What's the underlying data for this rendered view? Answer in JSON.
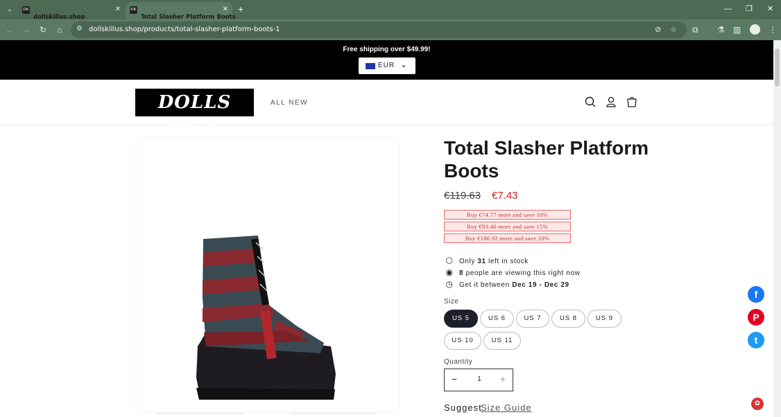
{
  "browser": {
    "tabs": [
      {
        "title": "dollskillus.shop",
        "active": false
      },
      {
        "title": "Total Slasher Platform Boots",
        "active": true
      }
    ],
    "favicon_text": "DK",
    "url": "dollskillus.shop/products/total-slasher-platform-boots-1",
    "toolbar_color": "#5b7a63"
  },
  "announcement": {
    "message": "Free shipping over $49.99!",
    "currency": "EUR"
  },
  "header": {
    "logo": "DOLLS KILL",
    "nav_all_new": "ALL NEW"
  },
  "product": {
    "title": "Total Slasher Platform Boots",
    "price_original": "€119.63",
    "price_sale": "€7.43",
    "promos": [
      "Buy €74.77 more and save 10%",
      "Buy €93.46 more and save 15%",
      "Buy €186.92 more and save 20%"
    ],
    "stock": {
      "prefix": "Only",
      "count": "31",
      "suffix": "left in stock"
    },
    "viewers": {
      "count": "8",
      "suffix": "people are viewing this right now"
    },
    "delivery": {
      "prefix": "Get it between",
      "range": "Dec 19 - Dec 29"
    },
    "size_label": "Size",
    "sizes": [
      "US 5",
      "US 6",
      "US 7",
      "US 8",
      "US 9",
      "US 10",
      "US 11"
    ],
    "selected_size": "US 5",
    "quantity_label": "Quantity",
    "quantity": "1",
    "suggest": "Suggest",
    "size_guide": "Size Guide"
  },
  "social": [
    {
      "icon": "facebook-icon",
      "glyph": "f",
      "color": "#1877f2"
    },
    {
      "icon": "pinterest-icon",
      "glyph": "P",
      "color": "#e60023"
    },
    {
      "icon": "twitter-icon",
      "glyph": "t",
      "color": "#1d9bf0"
    }
  ],
  "colors": {
    "sale_red": "#d02020",
    "selected_pill": "#1f1f2b",
    "announcement_bg": "#000000"
  }
}
